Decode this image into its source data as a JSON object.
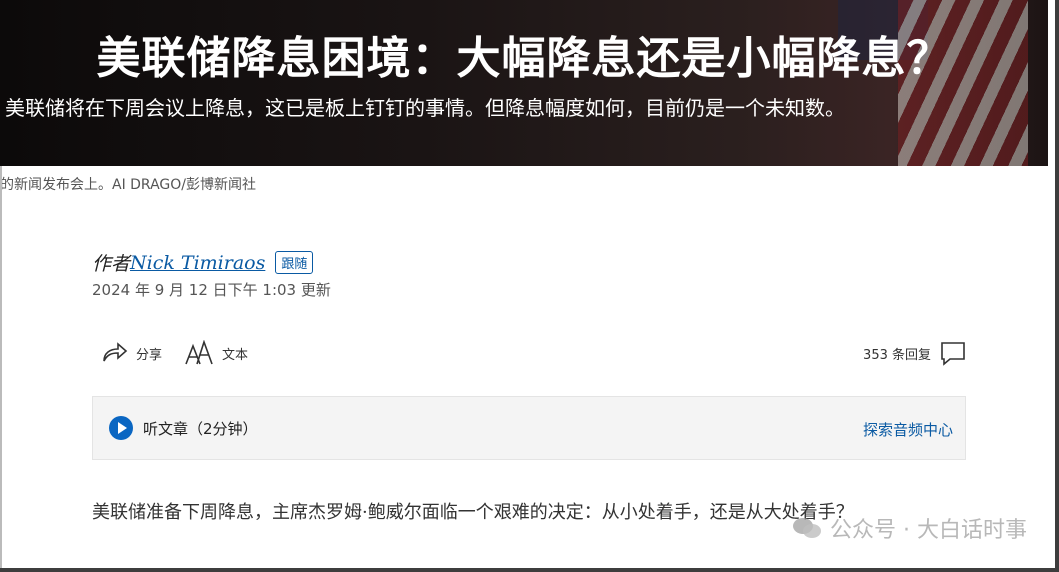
{
  "hero": {
    "title": "美联储降息困境：大幅降息还是小幅降息？",
    "subtitle": "美联储将在下周会议上降息，这已是板上钉钉的事情。但降息幅度如何，目前仍是一个未知数。"
  },
  "caption": "的新闻发布会上。AI DRAGO/彭博新闻社",
  "byline": {
    "prefix": "作者",
    "author": "Nick Timiraos",
    "follow": "跟随",
    "timestamp": "2024 年 9 月 12 日下午 1:03 更新"
  },
  "tools": {
    "share": "分享",
    "text": "文本",
    "replies": "353 条回复"
  },
  "audio": {
    "listen": "听文章（2分钟）",
    "center": "探索音频中心"
  },
  "article": {
    "paragraph": "美联储准备下周降息，主席杰罗姆·鲍威尔面临一个艰难的决定：从小处着手，还是从大处着手？"
  },
  "watermark": {
    "text": "公众号 · 大白话时事"
  }
}
